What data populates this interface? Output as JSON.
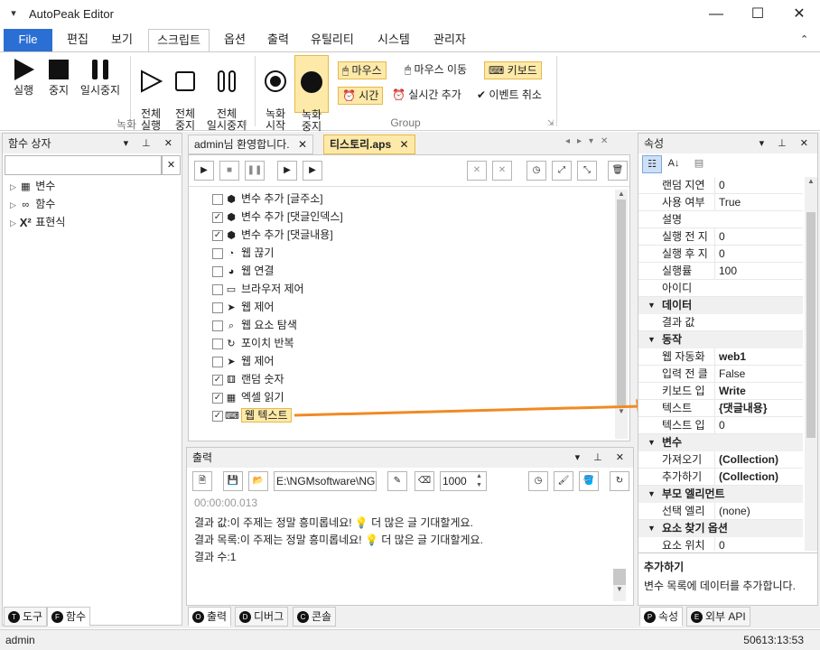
{
  "window": {
    "title": "AutoPeak Editor",
    "minimize": "—",
    "maximize": "☐",
    "close": "✕"
  },
  "menu": {
    "file": "File",
    "tabs": [
      "편집",
      "보기",
      "스크립트",
      "옵션",
      "출력",
      "유틸리티",
      "시스템",
      "관리자"
    ],
    "collapse": "⌃"
  },
  "ribbon": {
    "record_group": {
      "label": "녹화",
      "buttons": [
        "실행",
        "중지",
        "일시중지",
        "전체\n실행",
        "전체\n중지",
        "전체\n일시중지"
      ]
    },
    "group_group": {
      "label": "Group",
      "record_start": "녹화\n시작",
      "record_stop": "녹화\n중지",
      "mouse": "마우스",
      "mouse_move": "마우스 이동",
      "keyboard": "키보드",
      "time": "시간",
      "realtime_add": "실시간 추가",
      "event_cancel": "이벤트 취소"
    }
  },
  "left_panel": {
    "title": "함수 상자",
    "search": {
      "value": "",
      "clear": "✕"
    },
    "items": [
      "변수",
      "함수",
      "표현식"
    ],
    "tabs": [
      {
        "badge": "T",
        "label": "도구"
      },
      {
        "badge": "F",
        "label": "함수"
      }
    ]
  },
  "doc_tabs": [
    {
      "label": "admin님 환영합니다.",
      "close": "✕"
    },
    {
      "label": "티스토리.aps",
      "close": "✕"
    }
  ],
  "script_steps": [
    {
      "label": "변수 추가 [글주소]",
      "checked": false,
      "icon": "cube-icon"
    },
    {
      "label": "변수 추가 [댓글인덱스]",
      "checked": true,
      "icon": "cube-icon"
    },
    {
      "label": "변수 추가 [댓글내용]",
      "checked": true,
      "icon": "cube-icon"
    },
    {
      "label": "웹 끊기",
      "checked": false,
      "icon": "web-disconnect-icon"
    },
    {
      "label": "웹 연결",
      "checked": false,
      "icon": "web-connect-icon"
    },
    {
      "label": "브라우저 제어",
      "checked": false,
      "icon": "browser-icon"
    },
    {
      "label": "웹 제어",
      "checked": false,
      "icon": "compass-icon"
    },
    {
      "label": "웹 요소 탐색",
      "checked": false,
      "icon": "magnifier-icon"
    },
    {
      "label": "포이치 반복",
      "checked": false,
      "icon": "loop-icon"
    },
    {
      "label": "웹 제어",
      "checked": false,
      "icon": "compass-icon"
    },
    {
      "label": "랜덤 숫자",
      "checked": true,
      "icon": "dice-icon"
    },
    {
      "label": "엑셀 읽기",
      "checked": true,
      "icon": "excel-icon"
    },
    {
      "label": "웹 텍스트",
      "checked": true,
      "icon": "keyboard-icon"
    }
  ],
  "output_panel": {
    "title": "출력",
    "path": "E:\\NGMsoftware\\NG",
    "count": "1000",
    "lines": [
      "00:00:00.013",
      "결과 값:이 주제는 정말 흥미롭네요! 💡 더 많은 글 기대할게요.",
      "결과 목록:이 주제는 정말 흥미롭네요! 💡 더 많은 글 기대할게요.",
      "결과 수:1"
    ],
    "tabs": [
      {
        "badge": "O",
        "label": "출력"
      },
      {
        "badge": "D",
        "label": "디버그"
      },
      {
        "badge": "C",
        "label": "콘솔"
      }
    ]
  },
  "properties": {
    "title": "속성",
    "rows_top": [
      {
        "k": "랜덤 지연",
        "v": "0"
      },
      {
        "k": "사용 여부",
        "v": "True"
      },
      {
        "k": "설명",
        "v": ""
      },
      {
        "k": "실행 전 지",
        "v": "0"
      },
      {
        "k": "실행 후 지",
        "v": "0"
      },
      {
        "k": "실행률",
        "v": "100"
      },
      {
        "k": "아이디",
        "v": ""
      }
    ],
    "cat_data": "데이터",
    "rows_data": [
      {
        "k": "결과 값",
        "v": ""
      }
    ],
    "cat_action": "동작",
    "rows_action": [
      {
        "k": "웹 자동화",
        "v": "web1",
        "bold": true
      },
      {
        "k": "입력 전 클",
        "v": "False"
      },
      {
        "k": "키보드 입",
        "v": "Write",
        "bold": true
      },
      {
        "k": "텍스트",
        "v": "{댓글내용}",
        "bold": true
      },
      {
        "k": "텍스트 입",
        "v": "0"
      }
    ],
    "cat_var": "변수",
    "rows_var": [
      {
        "k": "가져오기",
        "v": "(Collection)",
        "bold": true
      },
      {
        "k": "추가하기",
        "v": "(Collection)",
        "bold": true
      }
    ],
    "cat_parent": "부모 엘리먼트",
    "rows_parent": [
      {
        "k": "선택 엘리",
        "v": "(none)"
      }
    ],
    "cat_find": "요소 찾기 옵션",
    "rows_find": [
      {
        "k": "요소 위치",
        "v": "0"
      }
    ],
    "desc_title": "추가하기",
    "desc_text": "변수 목록에 데이터를 추가합니다.",
    "tabs": [
      {
        "badge": "P",
        "label": "속성"
      },
      {
        "badge": "E",
        "label": "외부 API"
      }
    ]
  },
  "status": {
    "user": "admin",
    "time": "50613:13:53"
  },
  "colors": {
    "accent": "#2b6fd4",
    "highlight": "#fde9a8",
    "arrow": "#f08a24"
  }
}
